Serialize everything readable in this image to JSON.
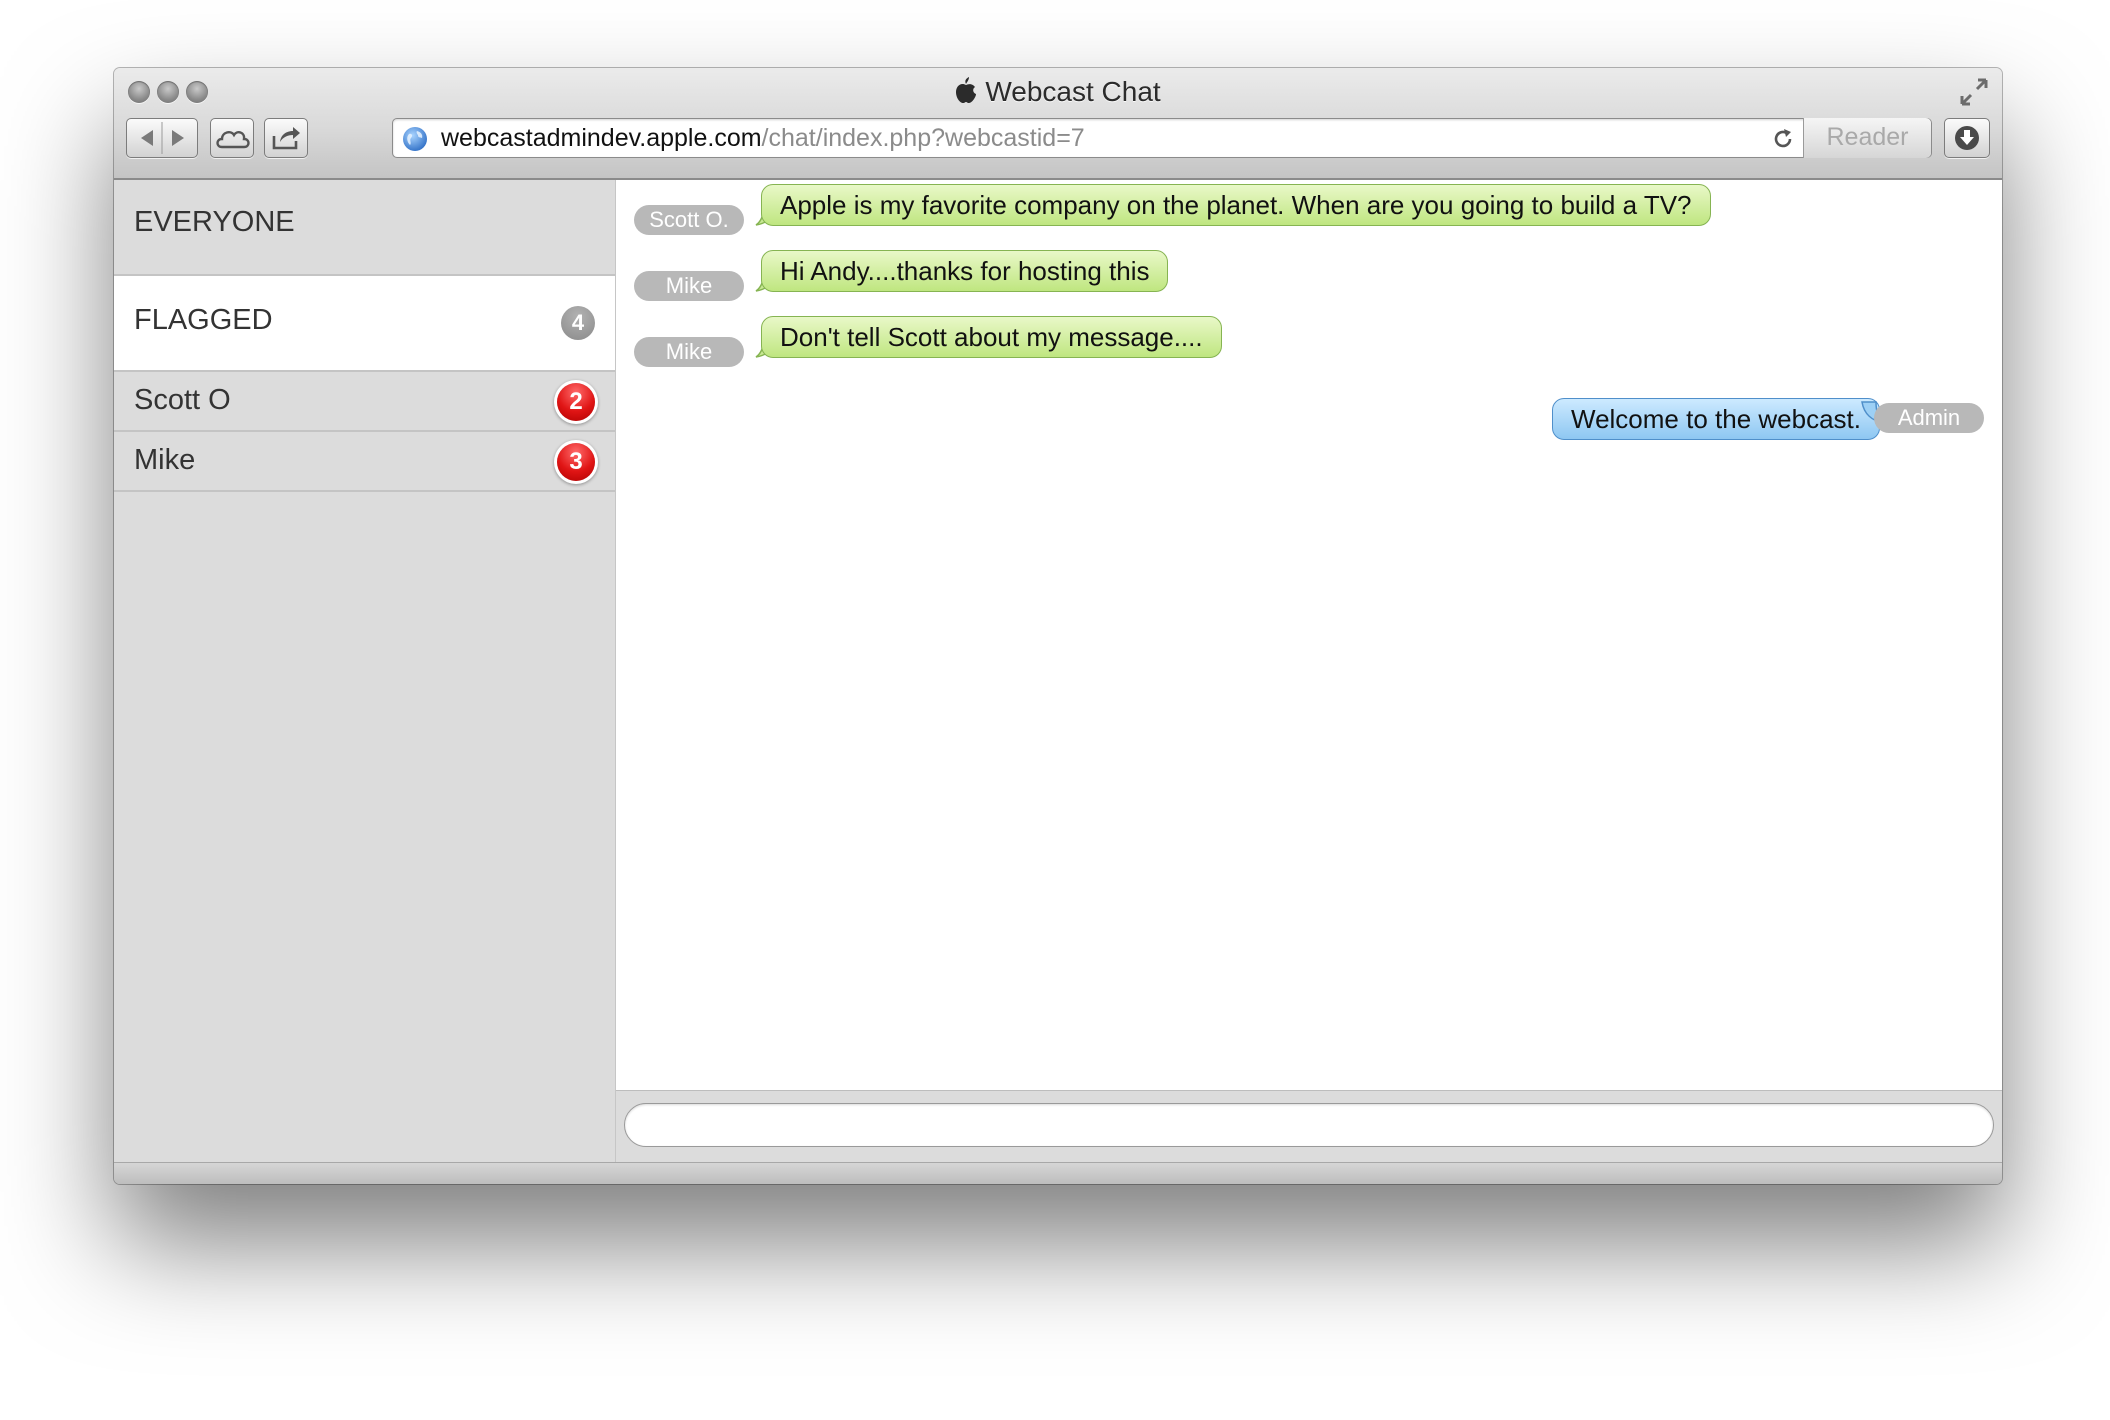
{
  "window": {
    "title": "Webcast Chat"
  },
  "toolbar": {
    "url_host": "webcastadmindev.apple.com",
    "url_path": "/chat/index.php?webcastid=7",
    "reader_label": "Reader"
  },
  "sidebar": {
    "items": [
      {
        "label": "EVERYONE",
        "badge": ""
      },
      {
        "label": "FLAGGED",
        "badge": "4"
      },
      {
        "label": "Scott O",
        "badge": "2"
      },
      {
        "label": "Mike",
        "badge": "3"
      }
    ]
  },
  "messages": [
    {
      "sender": "Scott O.",
      "text": "Apple is my favorite company on the planet. When are you going to build a TV?"
    },
    {
      "sender": "Mike",
      "text": "Hi Andy....thanks for hosting this"
    },
    {
      "sender": "Mike",
      "text": "Don't tell Scott about my message...."
    },
    {
      "sender": "Admin",
      "text": "Welcome to the webcast."
    }
  ],
  "colors": {
    "incoming_bubble": "#c8ea8f",
    "outgoing_bubble": "#9fd1f6",
    "badge_red": "#e01515",
    "badge_gray": "#9a9a9a"
  }
}
